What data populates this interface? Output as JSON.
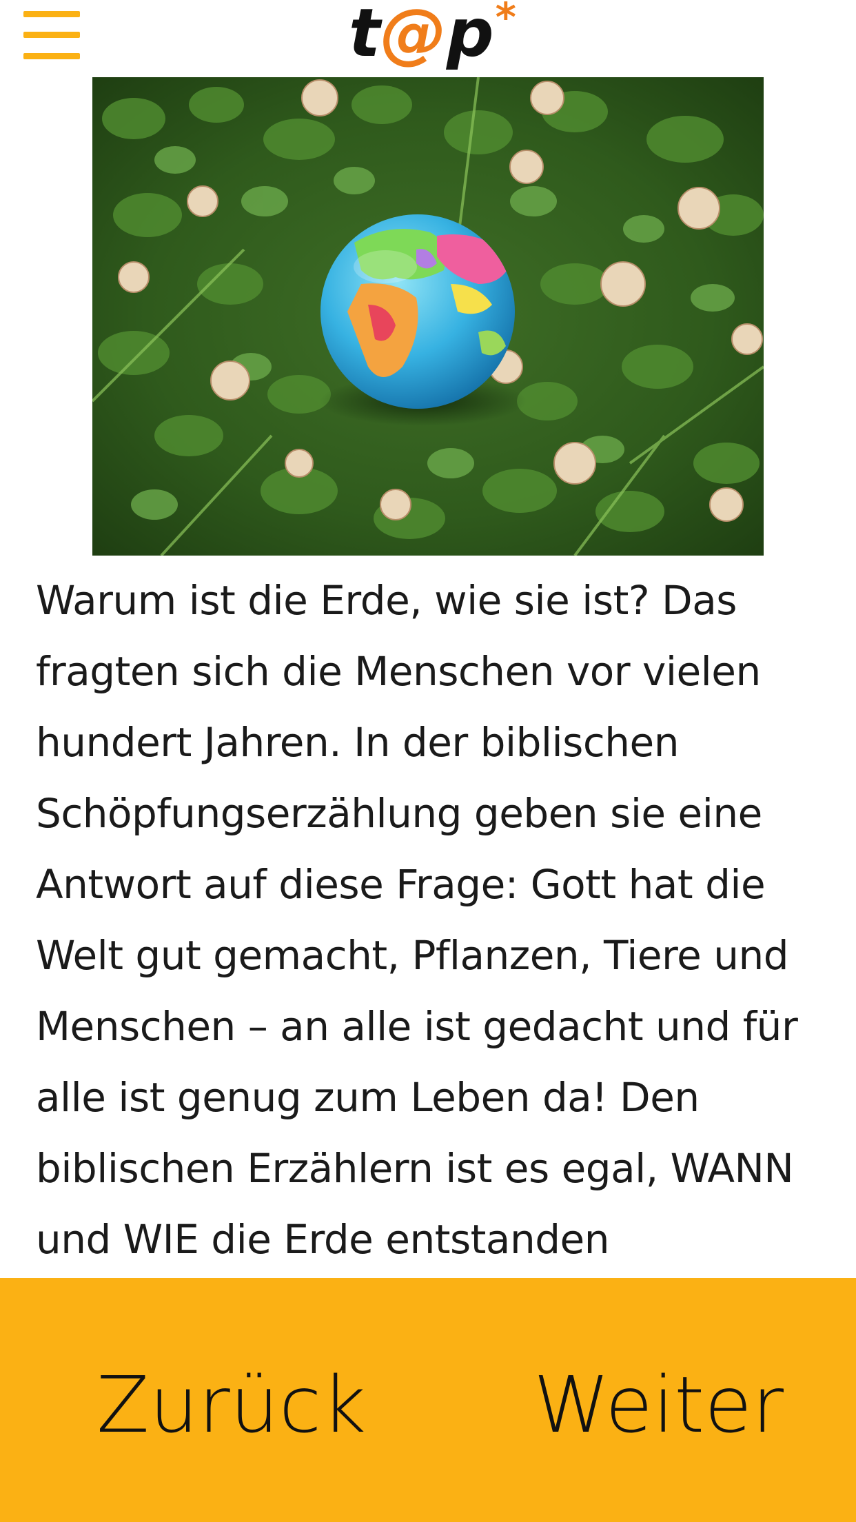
{
  "header": {
    "logo": {
      "t": "t",
      "at": "@",
      "p": "p",
      "star": "*"
    },
    "menu_icon": "hamburger-menu-icon"
  },
  "photo": {
    "alt_subject": "globe-in-clover-photo"
  },
  "article": {
    "text": "Warum ist die Erde, wie sie ist? Das fragten sich die Menschen vor vielen hundert Jahren. In der biblischen Schöpfungserzählung geben sie eine Antwort auf diese Frage: Gott hat die Welt gut gemacht, Pflanzen, Tiere und Menschen – an alle ist gedacht und für alle ist genug zum Leben da! Den biblischen Erzählern ist es egal, WANN und WIE die Erde entstanden"
  },
  "footer": {
    "back_label": "Zurück",
    "next_label": "Weiter"
  },
  "colors": {
    "accent": "#fbb114",
    "logo_orange": "#f07d1a",
    "text": "#1a1a1a"
  }
}
